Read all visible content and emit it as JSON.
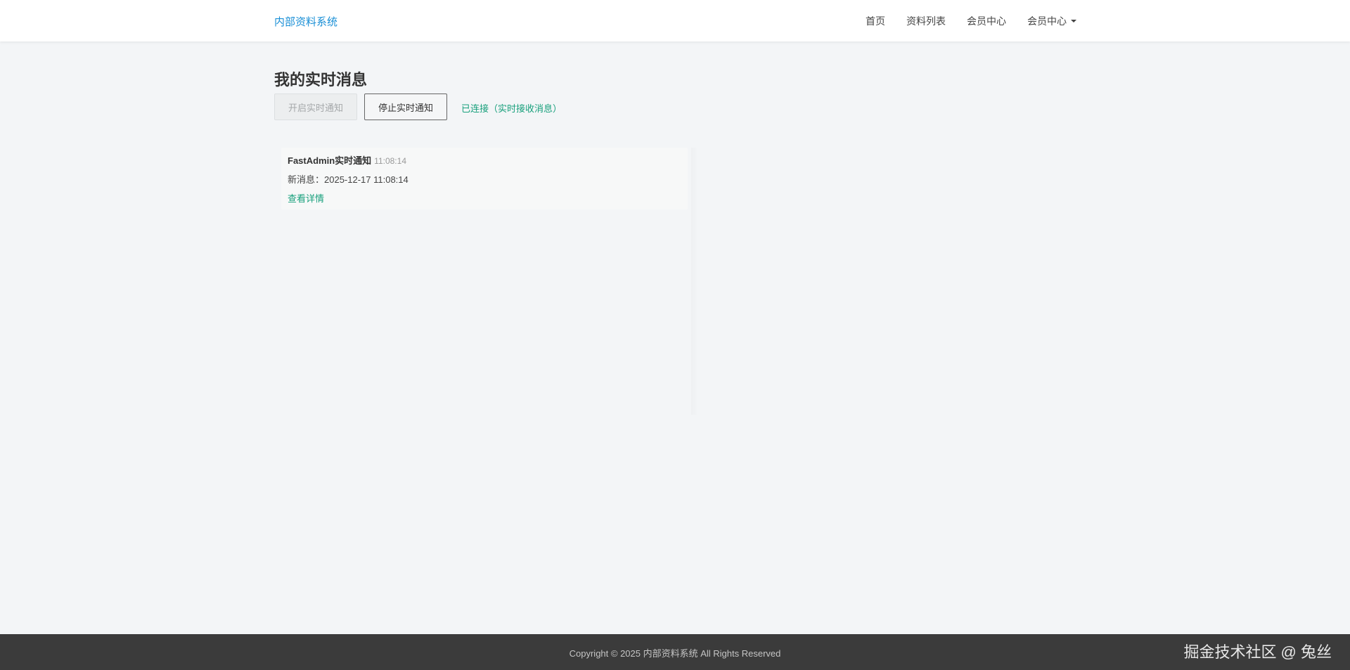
{
  "navbar": {
    "brand": "内部资料系统",
    "links": [
      {
        "label": "首页"
      },
      {
        "label": "资料列表"
      },
      {
        "label": "会员中心"
      },
      {
        "label": "会员中心",
        "dropdown": true
      }
    ]
  },
  "main": {
    "title": "我的实时消息",
    "start_button": "开启实时通知",
    "stop_button": "停止实时通知",
    "status": "已连接（实时接收消息）",
    "messages": [
      {
        "title": "FastAdmin实时通知",
        "time": "11:08:14",
        "body": "新消息：2025-12-17 11:08:14",
        "link": "查看详情"
      }
    ]
  },
  "footer": {
    "copyright": "Copyright © 2025 内部资料系统 All Rights Reserved",
    "watermark": "掘金技术社区 @ 兔丝"
  },
  "colors": {
    "brand": "#1a8fd6",
    "accent_green": "#18a07c",
    "footer_bg": "#3b3b3b",
    "page_bg": "#f3f5f7"
  },
  "icons": {
    "dropdown": "caret-down-icon"
  }
}
